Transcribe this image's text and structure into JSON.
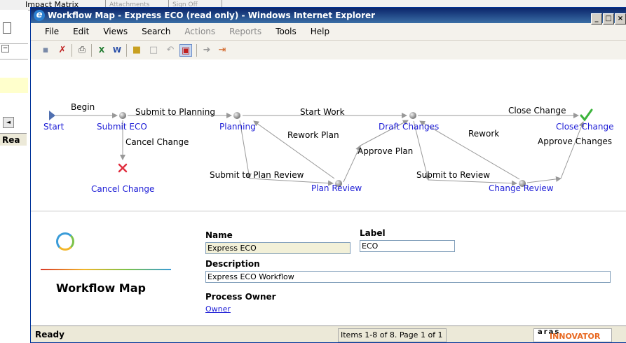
{
  "background": {
    "tabs": [
      "Impact Matrix",
      "Attachments",
      "Sign Off"
    ],
    "status": "Rea"
  },
  "window": {
    "title": "Workflow Map - Express ECO (read only) - Windows Internet Explorer",
    "buttons": [
      "_",
      "□",
      "×"
    ]
  },
  "menu": [
    "File",
    "Edit",
    "Views",
    "Search",
    "Actions",
    "Reports",
    "Tools",
    "Help"
  ],
  "menu_disabled": [
    "Actions",
    "Reports"
  ],
  "toolbar": {
    "icons": [
      "save-icon",
      "cancel-icon",
      "print-icon",
      "excel-icon",
      "word-icon",
      "lock-icon",
      "unlock-icon",
      "undo-icon",
      "workflow-icon",
      "claim-icon",
      "exit-icon"
    ]
  },
  "workflow": {
    "nodes": {
      "start": "Start",
      "submit_eco": "Submit ECO",
      "planning": "Planning",
      "draft_changes": "Draft Changes",
      "close_change": "Close Change",
      "cancel_change": "Cancel Change",
      "plan_review": "Plan Review",
      "change_review": "Change Review"
    },
    "paths": {
      "begin": "Begin",
      "submit_to_planning": "Submit to Planning",
      "start_work": "Start Work",
      "close_change": "Close Change",
      "cancel_change": "Cancel Change",
      "rework_plan": "Rework Plan",
      "approve_plan": "Approve Plan",
      "rework": "Rework",
      "approve_changes": "Approve Changes",
      "submit_to_plan_review": "Submit to Plan Review",
      "submit_to_review": "Submit to Review"
    }
  },
  "form": {
    "heading": "Workflow Map",
    "name_label": "Name",
    "name_value": "Express ECO",
    "label_label": "Label",
    "label_value": "ECO",
    "description_label": "Description",
    "description_value": "Express ECO Workflow",
    "owner_label": "Process Owner",
    "owner_link": "Owner"
  },
  "status": {
    "ready": "Ready",
    "items": "Items 1-8 of 8. Page 1 of 1",
    "brand_top": "aras",
    "brand_main": "INNOVATOR"
  },
  "colors": {
    "node_link": "#1c1cd6",
    "title_gradient": "#0a246a",
    "name_field_bg": "#f2f0d8",
    "brand_accent": "#e86820"
  }
}
